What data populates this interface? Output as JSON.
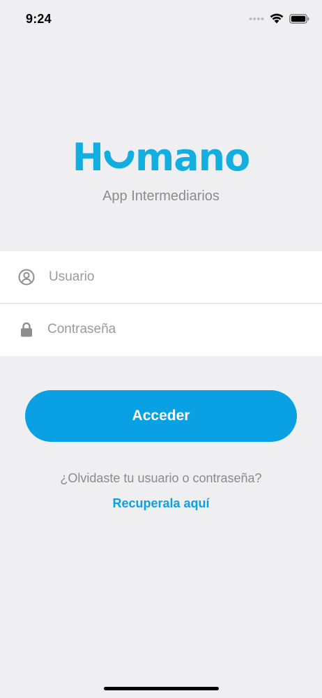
{
  "status_bar": {
    "time": "9:24",
    "icons": [
      "signal-dots-icon",
      "wifi-icon",
      "battery-icon"
    ]
  },
  "logo": {
    "brand_prefix": "H",
    "brand_suffix": "mano",
    "subtitle": "App Intermediarios",
    "color": "#13aee0"
  },
  "form": {
    "user_placeholder": "Usuario",
    "user_value": "",
    "user_icon": "user-circle-icon",
    "password_placeholder": "Contraseña",
    "password_value": "",
    "password_icon": "lock-icon"
  },
  "login": {
    "button_label": "Acceder",
    "button_color": "#0aa1e4"
  },
  "recovery": {
    "question": "¿Olvidaste tu usuario o contraseña?",
    "link_label": "Recuperala aquí"
  }
}
